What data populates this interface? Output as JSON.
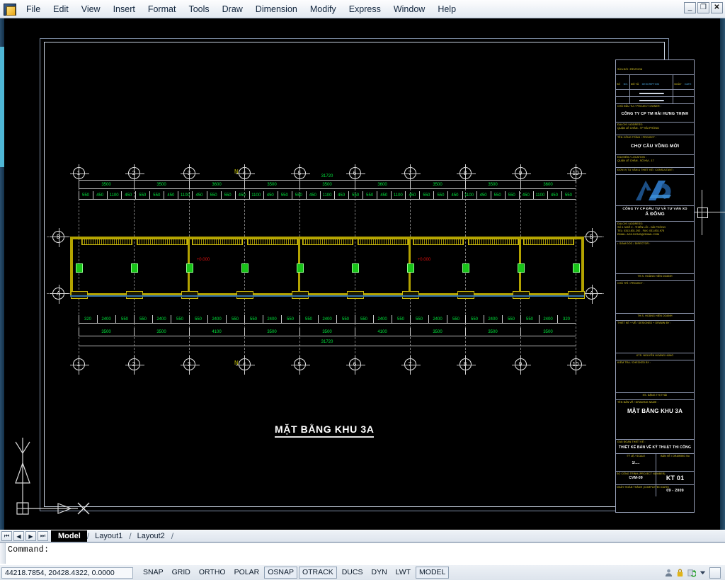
{
  "app": {
    "menu": [
      "File",
      "Edit",
      "View",
      "Insert",
      "Format",
      "Tools",
      "Draw",
      "Dimension",
      "Modify",
      "Express",
      "Window",
      "Help"
    ],
    "window_buttons": [
      {
        "name": "minimize",
        "glyph": "_"
      },
      {
        "name": "restore",
        "glyph": "❐"
      },
      {
        "name": "close",
        "glyph": "✕"
      }
    ]
  },
  "tabs": {
    "nav": [
      "⏮",
      "◀",
      "▶",
      "⏭"
    ],
    "items": [
      {
        "label": "Model",
        "active": true
      },
      {
        "label": "Layout1",
        "active": false
      },
      {
        "label": "Layout2",
        "active": false
      }
    ]
  },
  "command": {
    "prompt": "Command:"
  },
  "status": {
    "coordinates": "44218.7854, 20428.4322, 0.0000",
    "toggles": [
      {
        "label": "SNAP",
        "on": false
      },
      {
        "label": "GRID",
        "on": false
      },
      {
        "label": "ORTHO",
        "on": false
      },
      {
        "label": "POLAR",
        "on": false
      },
      {
        "label": "OSNAP",
        "on": true
      },
      {
        "label": "OTRACK",
        "on": true
      },
      {
        "label": "DUCS",
        "on": false
      },
      {
        "label": "DYN",
        "on": false
      },
      {
        "label": "LWT",
        "on": false
      },
      {
        "label": "MODEL",
        "on": true
      }
    ],
    "tray_icons": [
      "communication-center-icon",
      "lock-icon",
      "refresh-icon",
      "chevron-down-icon",
      "fullscreen-icon"
    ]
  },
  "drawing": {
    "plan_title": "MẶT BẰNG KHU 3A",
    "level_markers": [
      "+0.000",
      "+0.000"
    ],
    "grid_labels_top": [
      "1",
      "2",
      "3",
      "4",
      "5",
      "6",
      "7",
      "8",
      "9",
      "10"
    ],
    "grid_labels_bottom": [
      "1",
      "2",
      "3",
      "4",
      "5",
      "6",
      "7",
      "8",
      "9",
      "10"
    ],
    "grid_labels_left": [
      "B",
      "A"
    ],
    "grid_labels_right": [
      "B",
      "A"
    ],
    "dims_top_major": [
      "3500",
      "3500",
      "3600",
      "3500",
      "3500",
      "3600",
      "3500",
      "3500",
      "3600"
    ],
    "dims_top_minor": [
      "550",
      "450",
      "1100",
      "450",
      "550",
      "550",
      "450",
      "1100",
      "450",
      "550",
      "550",
      "450",
      "1100",
      "450",
      "550",
      "550",
      "450",
      "1100",
      "450",
      "550",
      "550",
      "450",
      "1100",
      "450",
      "550",
      "550",
      "450",
      "1100",
      "450",
      "550",
      "550",
      "450",
      "1100",
      "450",
      "550"
    ],
    "dims_bottom_minor": [
      "320",
      "2400",
      "550",
      "550",
      "2400",
      "550",
      "550",
      "2400",
      "550",
      "550",
      "2400",
      "550",
      "550",
      "2400",
      "550",
      "550",
      "2400",
      "550",
      "550",
      "2400",
      "550",
      "550",
      "2400",
      "550",
      "550",
      "2400",
      "320"
    ],
    "dims_bottom_major": [
      "3500",
      "3500",
      "4100",
      "3500",
      "3500",
      "4100",
      "3500",
      "3500",
      "3500"
    ],
    "dims_overall_top": "31720",
    "dims_overall_bottom": "31720",
    "north_label": "N"
  },
  "titleblock": {
    "rev_header": "SỪA ĐỔI / REVISION",
    "rev_cols": [
      {
        "vn": "SỐ",
        "en": "NO."
      },
      {
        "vn": "MÔ TẢ",
        "en": "DESCRIPTION"
      },
      {
        "vn": "NGÀY",
        "en": "DATE"
      }
    ],
    "owner_label": "CHỦ ĐẦU TƯ / PROJECT OWNER :",
    "owner_name": "CÔNG TY CP TM HẢI HƯNG THỊNH",
    "owner_addr_label": "ĐỊA CHỈ / ADDRESS:",
    "owner_addr": "QUẬN LÊ CHÂN - TP HẢI PHÒNG",
    "project_label": "TÊN CÔNG TRÌNH / PROJECT :",
    "project_name": "CHỢ CẦU VỒNG MỚI",
    "project_addr_label": "ĐỊA ĐIỂM / LOCATION :",
    "project_addr": "QUẬN LÊ CHÂN - SỐ KM - 17",
    "consultant_label": "ĐƠN VỊ TƯ VẤN & THIẾT KẾ / CONSULTANT :",
    "consultant_name": "CÔNG TY CP ĐẦU TƯ VÀ TƯ VẤN XD",
    "consultant_name2": "Á ĐÔNG",
    "consultant_addr_label": "ĐỊA CHỈ / ADDRESS:",
    "consultant_addr1": "SỐ 1 NGÕ 2 - THIÊN LỖI - HẢI PHÒNG",
    "consultant_addr2": "TEL: 0313.831.292 - FAX: 031.831.975",
    "consultant_addr3": "EMAIL: ADX.DONG@GMAIL.COM",
    "director_label": "• GIÁM ĐỐC / DIRECTOR :",
    "approve1_label": "TH.S. HOÀNG HIỀN DOANH",
    "owner_sign_label": "CHỦ TRÌ / PROJECT :",
    "approve2_label": "TH.S. HOÀNG HIỀN DOANH",
    "design_label": "THIẾT KẾ + VẼ / DESIGNED + DRAWN BY :",
    "checker_name": "KTS. NGUYỄN HOÀNG HÙNG",
    "check_label": "KIỂM TRA / CHECKED BY :",
    "signature_label": "KS. ĐẶNG THỊ THÁI",
    "dwg_name_label": "TÊN BẢN VẼ / DRAWING NAME :",
    "dwg_name": "MẶT BẰNG KHU 3A",
    "stage_label": "GIAI ĐOẠN THIẾT KẾ :",
    "stage_value": "THIẾT KẾ BẢN VẼ KỸ THUẬT THI CÔNG",
    "scale_label": "TỶ LỆ / SCALE",
    "scale_value": "1/....",
    "sheet_label": "BẢN VẼ / DRAWING  No",
    "sheet_value": "KT 01",
    "projno_label": "SỐ CÔNG TRÌNH (PROJECT NUMBER)",
    "projno_value": "CVM-09",
    "date_label": "NGÀY HOÀN THÀNH (COMPLETED DATE)",
    "date_value": "09 - 2009"
  },
  "colors": {
    "accent_green": "#00e83c",
    "accent_yellow": "#e3d02a",
    "accent_red": "#e01010",
    "accent_blue": "#2f6ea8",
    "canvas": "#000000"
  }
}
